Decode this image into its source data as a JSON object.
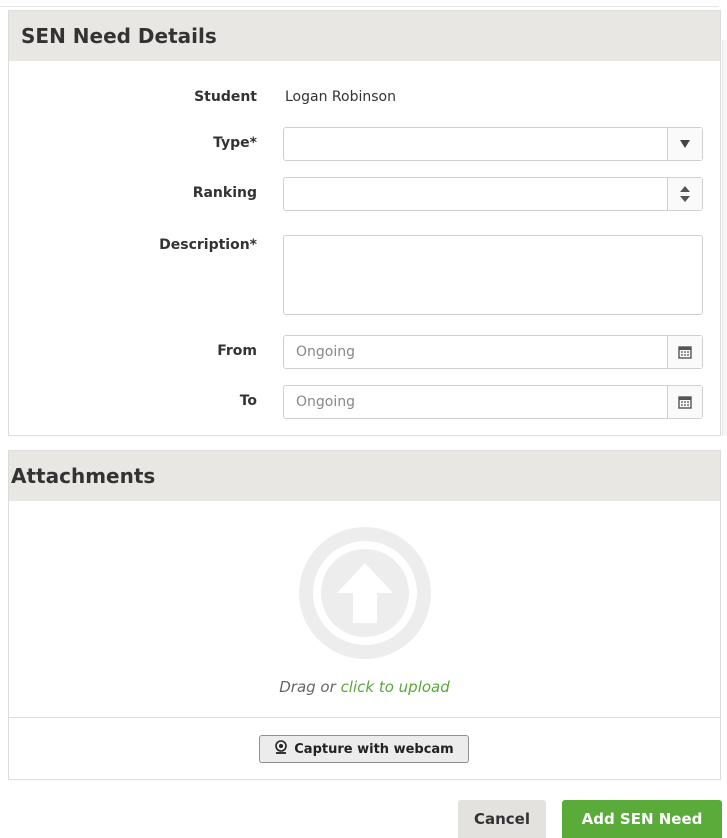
{
  "details": {
    "title": "SEN Need Details",
    "student_label": "Student",
    "student_value": "Logan Robinson",
    "type_label": "Type*",
    "type_value": "",
    "ranking_label": "Ranking",
    "ranking_value": "",
    "description_label": "Description*",
    "description_value": "",
    "from_label": "From",
    "from_placeholder": "Ongoing",
    "to_label": "To",
    "to_placeholder": "Ongoing"
  },
  "attachments": {
    "title": "Attachments",
    "drag_text": "Drag or",
    "upload_link": "click to upload",
    "webcam_button": "Capture with webcam"
  },
  "footer": {
    "cancel_label": "Cancel",
    "submit_label": "Add SEN Need"
  },
  "icons": {
    "select_caret": "triangle-down-icon",
    "stepper": "updown-arrows-icon",
    "calendar": "calendar-icon",
    "upload": "upload-arrow-icon",
    "webcam": "webcam-icon"
  },
  "colors": {
    "panel_header": "#e9e7e4",
    "primary_button": "#5aab3a",
    "link": "#58a83a"
  }
}
